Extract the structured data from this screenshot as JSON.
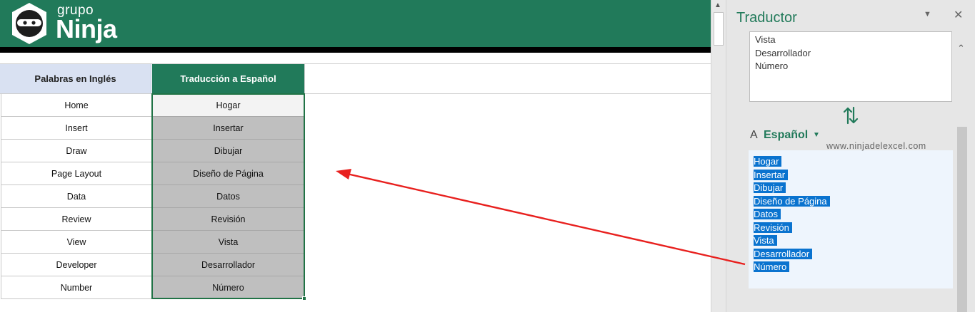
{
  "brand": {
    "small": "grupo",
    "big": "Ninja"
  },
  "table": {
    "header_en": "Palabras en Inglés",
    "header_es": "Traducción a Español",
    "rows": [
      {
        "en": "Home",
        "es": "Hogar"
      },
      {
        "en": "Insert",
        "es": "Insertar"
      },
      {
        "en": "Draw",
        "es": "Dibujar"
      },
      {
        "en": "Page Layout",
        "es": "Diseño de Página"
      },
      {
        "en": "Data",
        "es": "Datos"
      },
      {
        "en": "Review",
        "es": "Revisión"
      },
      {
        "en": "View",
        "es": "Vista"
      },
      {
        "en": "Developer",
        "es": "Desarrollador"
      },
      {
        "en": "Number",
        "es": "Número"
      }
    ]
  },
  "pane": {
    "title": "Traductor",
    "menu_icon": "chevron-down-icon",
    "close_icon": "close-icon",
    "source_lines": [
      "Vista",
      "Desarrollador",
      "Número"
    ],
    "swap_icon": "swap-icon",
    "to_label": "A",
    "to_language": "Español",
    "watermark": "www.ninjadelexcel.com",
    "target_lines": [
      "Hogar",
      "Insertar",
      "Dibujar",
      "Diseño de Página",
      "Datos",
      "Revisión",
      "Vista",
      "Desarrollador",
      "Número"
    ]
  },
  "colors": {
    "brand_green": "#217a5a",
    "header_blue": "#d9e1f2",
    "selection_highlight": "#0a73cf",
    "arrow_red": "#e8201e"
  }
}
